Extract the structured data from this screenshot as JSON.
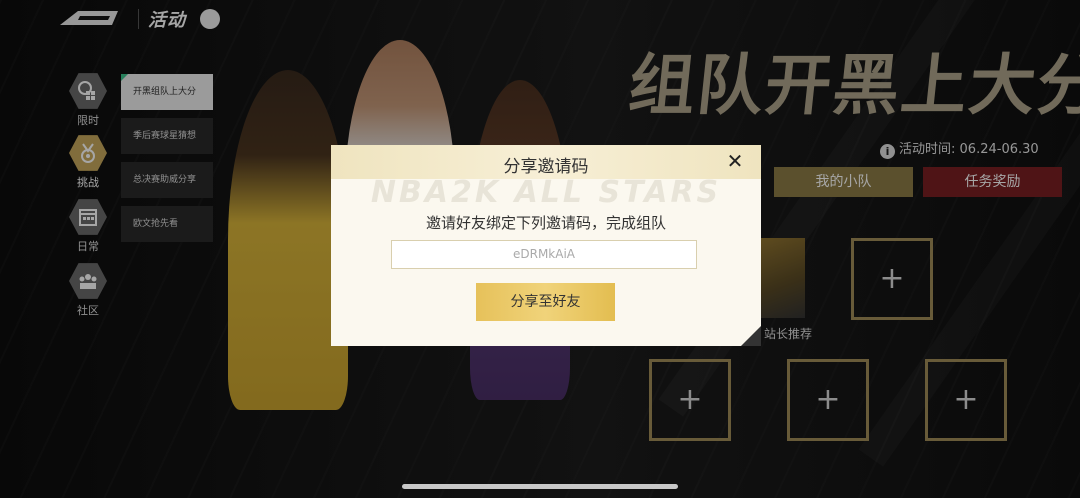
{
  "topbar": {
    "title": "活动"
  },
  "nav": [
    {
      "label": "限时",
      "icon": "clock-grid-icon",
      "active": false
    },
    {
      "label": "挑战",
      "icon": "medal-icon",
      "active": true
    },
    {
      "label": "日常",
      "icon": "calendar-icon",
      "active": false
    },
    {
      "label": "社区",
      "icon": "community-icon",
      "active": false
    }
  ],
  "submenu": [
    {
      "label": "开黑组队上大分",
      "active": true
    },
    {
      "label": "季后赛球星猜想",
      "active": false
    },
    {
      "label": "总决赛助威分享",
      "active": false
    },
    {
      "label": "欧文抢先看",
      "active": false
    }
  ],
  "event": {
    "title": "组队开黑上大分",
    "time_label": "活动时间:",
    "time_value": "06.24-06.30",
    "team_button": "我的小队",
    "task_button": "任务奖励",
    "member_name": "站长推荐",
    "add_symbol": "+"
  },
  "modal": {
    "title": "分享邀请码",
    "close_symbol": "✕",
    "watermark": "NBA2K ALL STARS",
    "description": "邀请好友绑定下列邀请码，完成组队",
    "invite_code": "eDRMkAiA",
    "share_button": "分享至好友"
  },
  "colors": {
    "accent_gold": "#c7a85c",
    "team_button": "#8c7c46",
    "task_button": "#7a1f22",
    "share_button": "#e6c15a"
  }
}
